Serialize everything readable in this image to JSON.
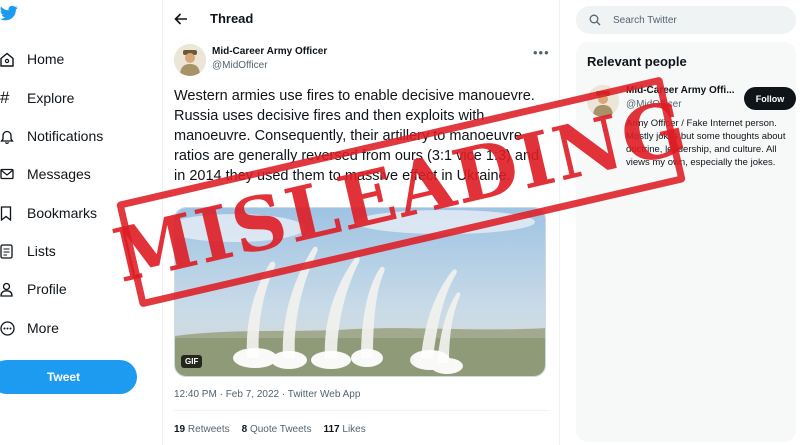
{
  "nav": {
    "logo_icon": "twitter-bird-icon",
    "items": [
      {
        "label": "Home",
        "icon": "home-icon"
      },
      {
        "label": "Explore",
        "icon": "hashtag-icon"
      },
      {
        "label": "Notifications",
        "icon": "bell-icon"
      },
      {
        "label": "Messages",
        "icon": "envelope-icon"
      },
      {
        "label": "Bookmarks",
        "icon": "bookmark-icon"
      },
      {
        "label": "Lists",
        "icon": "list-icon"
      },
      {
        "label": "Profile",
        "icon": "person-icon"
      },
      {
        "label": "More",
        "icon": "more-circle-icon"
      }
    ],
    "tweet_button": "Tweet"
  },
  "thread": {
    "title": "Thread",
    "author_name": "Mid-Career Army Officer",
    "author_handle": "@MidOfficer",
    "text": "Western armies use fires to enable decisive manouevre. Russia uses decisive fires and then exploits with manoeuvre. Consequently, their artillery to manoeuvre ratios are generally reversed from ours (3:1 vice 1:3) and in 2014 they used them to massive effect in Ukraine.",
    "media_badge": "GIF",
    "timestamp": "12:40 PM · Feb 7, 2022 · Twitter Web App",
    "stats": {
      "retweets_count": "19",
      "retweets_label": "Retweets",
      "quotes_count": "8",
      "quotes_label": "Quote Tweets",
      "likes_count": "117",
      "likes_label": "Likes"
    }
  },
  "search": {
    "placeholder": "Search Twitter"
  },
  "relevant": {
    "title": "Relevant people",
    "name": "Mid-Career Army Offi...",
    "handle": "@MidOfficer",
    "follow_label": "Follow",
    "bio": "Army Officer / Fake Internet person. Mostly jokes but some thoughts about doctrine, leadership, and culture. All views my own, especially the jokes."
  },
  "overlay": {
    "stamp_text": "MISLEADING"
  },
  "colors": {
    "accent": "#1d9bf0",
    "stamp_red": "#de1c24",
    "text_primary": "#0f1419",
    "text_secondary": "#536471"
  }
}
